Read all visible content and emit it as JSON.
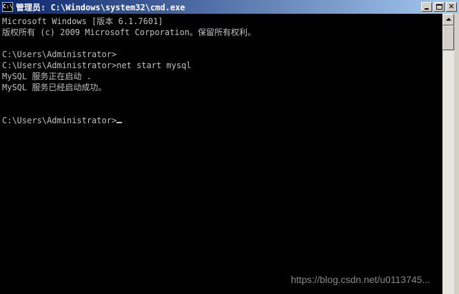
{
  "window": {
    "icon_text": "C:\\",
    "title": "管理员: C:\\Windows\\system32\\cmd.exe",
    "close_symbol": "✕"
  },
  "console": {
    "lines": [
      "Microsoft Windows [版本 6.1.7601]",
      "版权所有 (c) 2009 Microsoft Corporation。保留所有权利。",
      "",
      "C:\\Users\\Administrator>",
      "C:\\Users\\Administrator>net start mysql",
      "MySQL 服务正在启动 .",
      "MySQL 服务已经启动成功。",
      "",
      "",
      "C:\\Users\\Administrator>"
    ]
  },
  "watermark": "https://blog.csdn.net/u0113745..."
}
